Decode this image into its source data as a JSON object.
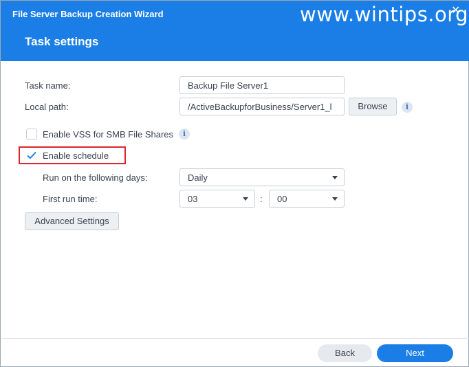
{
  "window": {
    "title": "File Server Backup Creation Wizard",
    "step_title": "Task settings",
    "watermark": "www.wintips.org"
  },
  "form": {
    "task_name_label": "Task name:",
    "task_name_value": "Backup File Server1",
    "local_path_label": "Local path:",
    "local_path_value": "/ActiveBackupforBusiness/Server1_l",
    "browse_label": "Browse",
    "vss_label": "Enable VSS for SMB File Shares",
    "vss_checked": false,
    "schedule_label": "Enable schedule",
    "schedule_checked": true,
    "run_days_label": "Run on the following days:",
    "run_days_value": "Daily",
    "first_run_label": "First run time:",
    "hour_value": "03",
    "time_separator": ":",
    "minute_value": "00",
    "advanced_label": "Advanced Settings"
  },
  "footer": {
    "back_label": "Back",
    "next_label": "Next"
  },
  "colors": {
    "accent": "#1a7ee6",
    "highlight": "#e0242c"
  },
  "icons": {
    "info": "info-icon",
    "check": "check-icon",
    "close": "close-icon",
    "dropdown": "chevron-down-icon"
  }
}
